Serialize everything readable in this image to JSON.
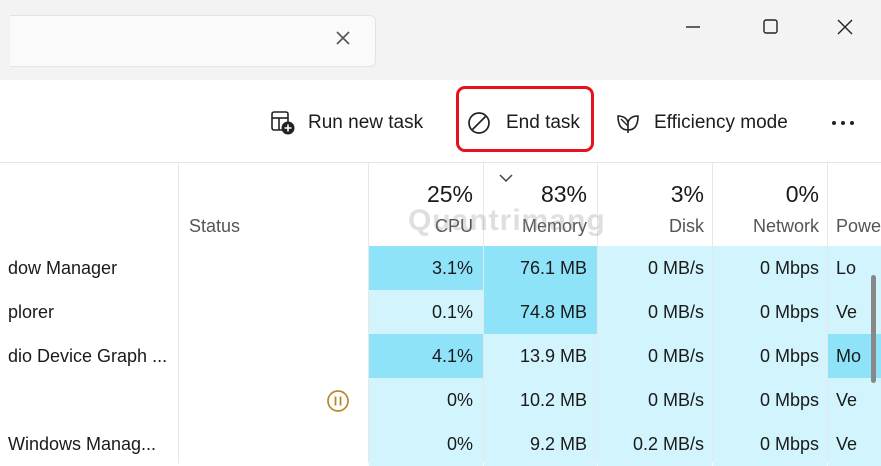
{
  "titlebar": {
    "search_clear_icon": "close-icon",
    "window_controls": [
      "minimize-icon",
      "maximize-icon",
      "close-icon"
    ]
  },
  "toolbar": {
    "run_new_task": "Run new task",
    "end_task": "End task",
    "efficiency_mode": "Efficiency mode",
    "more_icon": "more-icon"
  },
  "columns": {
    "status": "Status",
    "cpu": {
      "pct": "25%",
      "label": "CPU"
    },
    "memory": {
      "pct": "83%",
      "label": "Memory"
    },
    "disk": {
      "pct": "3%",
      "label": "Disk"
    },
    "network": {
      "pct": "0%",
      "label": "Network"
    },
    "power": {
      "label": "Powe"
    }
  },
  "rows": [
    {
      "name": "dow Manager",
      "status": "",
      "cpu": "3.1%",
      "memory": "76.1 MB",
      "disk": "0 MB/s",
      "network": "0 Mbps",
      "power": "Lo"
    },
    {
      "name": "plorer",
      "status": "",
      "cpu": "0.1%",
      "memory": "74.8 MB",
      "disk": "0 MB/s",
      "network": "0 Mbps",
      "power": "Ve"
    },
    {
      "name": "dio Device Graph ...",
      "status": "",
      "cpu": "4.1%",
      "memory": "13.9 MB",
      "disk": "0 MB/s",
      "network": "0 Mbps",
      "power": "Mo"
    },
    {
      "name": "",
      "status": "paused",
      "cpu": "0%",
      "memory": "10.2 MB",
      "disk": "0 MB/s",
      "network": "0 Mbps",
      "power": "Ve"
    },
    {
      "name": "Windows Manag...",
      "status": "",
      "cpu": "0%",
      "memory": "9.2 MB",
      "disk": "0.2 MB/s",
      "network": "0 Mbps",
      "power": "Ve"
    }
  ],
  "colors": {
    "light": "#d2f5fd",
    "medium": "#b2ecfb",
    "dark": "#8fe3f9",
    "highlight_border": "#e8101c"
  },
  "watermark": "Quantrimang"
}
